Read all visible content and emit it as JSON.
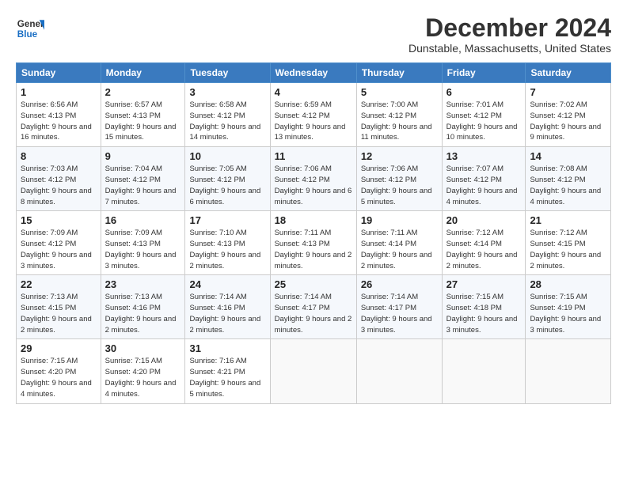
{
  "logo": {
    "line1": "General",
    "line2": "Blue"
  },
  "title": "December 2024",
  "subtitle": "Dunstable, Massachusetts, United States",
  "days_of_week": [
    "Sunday",
    "Monday",
    "Tuesday",
    "Wednesday",
    "Thursday",
    "Friday",
    "Saturday"
  ],
  "weeks": [
    [
      {
        "num": "1",
        "rise": "6:56 AM",
        "set": "4:13 PM",
        "daylight": "9 hours and 16 minutes."
      },
      {
        "num": "2",
        "rise": "6:57 AM",
        "set": "4:13 PM",
        "daylight": "9 hours and 15 minutes."
      },
      {
        "num": "3",
        "rise": "6:58 AM",
        "set": "4:12 PM",
        "daylight": "9 hours and 14 minutes."
      },
      {
        "num": "4",
        "rise": "6:59 AM",
        "set": "4:12 PM",
        "daylight": "9 hours and 13 minutes."
      },
      {
        "num": "5",
        "rise": "7:00 AM",
        "set": "4:12 PM",
        "daylight": "9 hours and 11 minutes."
      },
      {
        "num": "6",
        "rise": "7:01 AM",
        "set": "4:12 PM",
        "daylight": "9 hours and 10 minutes."
      },
      {
        "num": "7",
        "rise": "7:02 AM",
        "set": "4:12 PM",
        "daylight": "9 hours and 9 minutes."
      }
    ],
    [
      {
        "num": "8",
        "rise": "7:03 AM",
        "set": "4:12 PM",
        "daylight": "9 hours and 8 minutes."
      },
      {
        "num": "9",
        "rise": "7:04 AM",
        "set": "4:12 PM",
        "daylight": "9 hours and 7 minutes."
      },
      {
        "num": "10",
        "rise": "7:05 AM",
        "set": "4:12 PM",
        "daylight": "9 hours and 6 minutes."
      },
      {
        "num": "11",
        "rise": "7:06 AM",
        "set": "4:12 PM",
        "daylight": "9 hours and 6 minutes."
      },
      {
        "num": "12",
        "rise": "7:06 AM",
        "set": "4:12 PM",
        "daylight": "9 hours and 5 minutes."
      },
      {
        "num": "13",
        "rise": "7:07 AM",
        "set": "4:12 PM",
        "daylight": "9 hours and 4 minutes."
      },
      {
        "num": "14",
        "rise": "7:08 AM",
        "set": "4:12 PM",
        "daylight": "9 hours and 4 minutes."
      }
    ],
    [
      {
        "num": "15",
        "rise": "7:09 AM",
        "set": "4:12 PM",
        "daylight": "9 hours and 3 minutes."
      },
      {
        "num": "16",
        "rise": "7:09 AM",
        "set": "4:13 PM",
        "daylight": "9 hours and 3 minutes."
      },
      {
        "num": "17",
        "rise": "7:10 AM",
        "set": "4:13 PM",
        "daylight": "9 hours and 2 minutes."
      },
      {
        "num": "18",
        "rise": "7:11 AM",
        "set": "4:13 PM",
        "daylight": "9 hours and 2 minutes."
      },
      {
        "num": "19",
        "rise": "7:11 AM",
        "set": "4:14 PM",
        "daylight": "9 hours and 2 minutes."
      },
      {
        "num": "20",
        "rise": "7:12 AM",
        "set": "4:14 PM",
        "daylight": "9 hours and 2 minutes."
      },
      {
        "num": "21",
        "rise": "7:12 AM",
        "set": "4:15 PM",
        "daylight": "9 hours and 2 minutes."
      }
    ],
    [
      {
        "num": "22",
        "rise": "7:13 AM",
        "set": "4:15 PM",
        "daylight": "9 hours and 2 minutes."
      },
      {
        "num": "23",
        "rise": "7:13 AM",
        "set": "4:16 PM",
        "daylight": "9 hours and 2 minutes."
      },
      {
        "num": "24",
        "rise": "7:14 AM",
        "set": "4:16 PM",
        "daylight": "9 hours and 2 minutes."
      },
      {
        "num": "25",
        "rise": "7:14 AM",
        "set": "4:17 PM",
        "daylight": "9 hours and 2 minutes."
      },
      {
        "num": "26",
        "rise": "7:14 AM",
        "set": "4:17 PM",
        "daylight": "9 hours and 3 minutes."
      },
      {
        "num": "27",
        "rise": "7:15 AM",
        "set": "4:18 PM",
        "daylight": "9 hours and 3 minutes."
      },
      {
        "num": "28",
        "rise": "7:15 AM",
        "set": "4:19 PM",
        "daylight": "9 hours and 3 minutes."
      }
    ],
    [
      {
        "num": "29",
        "rise": "7:15 AM",
        "set": "4:20 PM",
        "daylight": "9 hours and 4 minutes."
      },
      {
        "num": "30",
        "rise": "7:15 AM",
        "set": "4:20 PM",
        "daylight": "9 hours and 4 minutes."
      },
      {
        "num": "31",
        "rise": "7:16 AM",
        "set": "4:21 PM",
        "daylight": "9 hours and 5 minutes."
      },
      null,
      null,
      null,
      null
    ]
  ]
}
